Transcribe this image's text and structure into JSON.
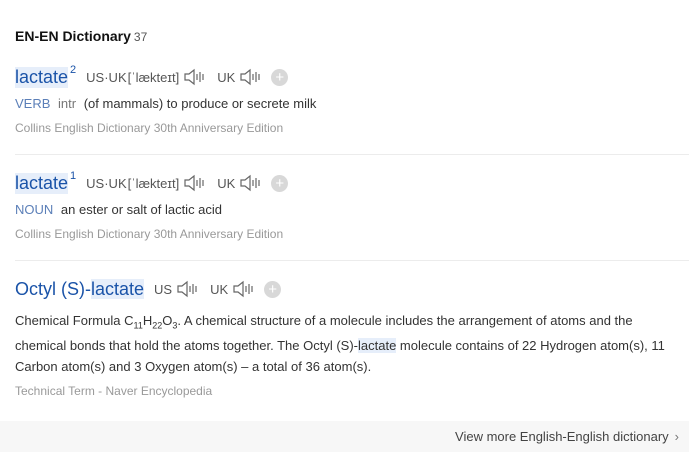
{
  "section": {
    "title": "EN-EN Dictionary",
    "count": "37"
  },
  "entries": [
    {
      "word": "lactate",
      "sup": "2",
      "us_uk_label": "US·UK",
      "phonetic": "[ˈlækteɪt]",
      "uk_label": "UK",
      "pos": "VERB",
      "grammar": "intr",
      "definition": "(of mammals) to produce or secrete milk",
      "source": "Collins English Dictionary 30th Anniversary Edition"
    },
    {
      "word": "lactate",
      "sup": "1",
      "us_uk_label": "US·UK",
      "phonetic": "[ˈlækteɪt]",
      "uk_label": "UK",
      "pos": "NOUN",
      "definition": "an ester or salt of lactic acid",
      "source": "Collins English Dictionary 30th Anniversary Edition"
    },
    {
      "word_prefix": "Octyl (S)-",
      "word_keyword": "lactate",
      "us_label": "US",
      "uk_label": "UK",
      "def_lead": "Chemical Formula C",
      "sub_c": "11",
      "h": "H",
      "sub_h": "22",
      "o": "O",
      "sub_o": "3",
      "def_part1": ". A chemical structure of a molecule includes the arrangement of atoms and the chemical bonds that hold the atoms together. The Octyl (S)-",
      "def_keyword": "lactate",
      "def_part2": " molecule contains of 22 Hydrogen atom(s), 11 Carbon atom(s) and 3 Oxygen atom(s) – a total of 36 atom(s).",
      "source": "Technical Term - Naver Encyclopedia"
    }
  ],
  "footer": {
    "more_label": "View more English-English dictionary",
    "chevron": "›"
  },
  "icons": {
    "speaker": "speaker-icon",
    "add": "plus-icon"
  },
  "colors": {
    "link": "#1a53a8",
    "highlight": "#e6eefa",
    "pos": "#5b7fb8"
  }
}
